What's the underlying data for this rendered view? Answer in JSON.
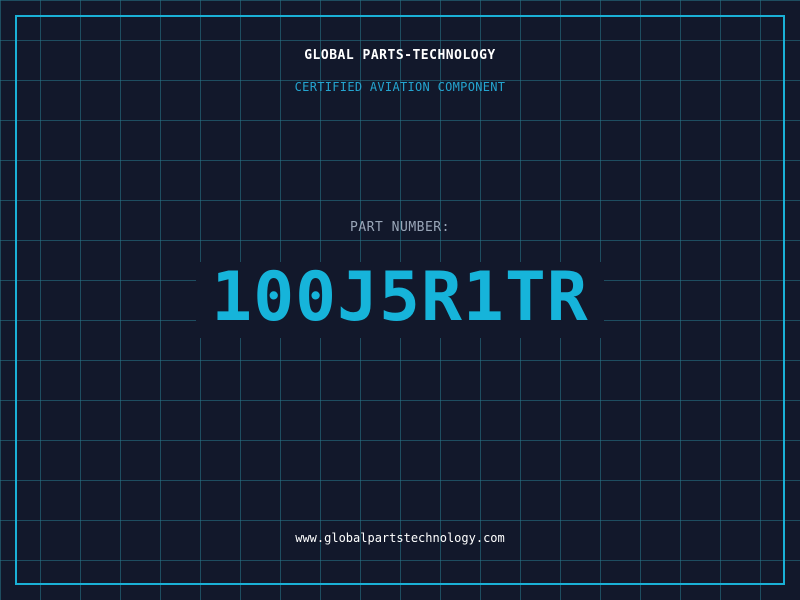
{
  "header": {
    "company": "GLOBAL PARTS-TECHNOLOGY",
    "tagline": "CERTIFIED AVIATION COMPONENT"
  },
  "part": {
    "label": "PART NUMBER:",
    "number": "100J5R1TR"
  },
  "footer": {
    "website": "www.globalpartstechnology.com"
  },
  "colors": {
    "background": "#12182b",
    "grid": "#28788c",
    "frame": "#1ab0d6",
    "accent": "#16b4da",
    "tagline": "#24a4cf",
    "label": "#9aa6b8",
    "text": "#ffffff"
  }
}
